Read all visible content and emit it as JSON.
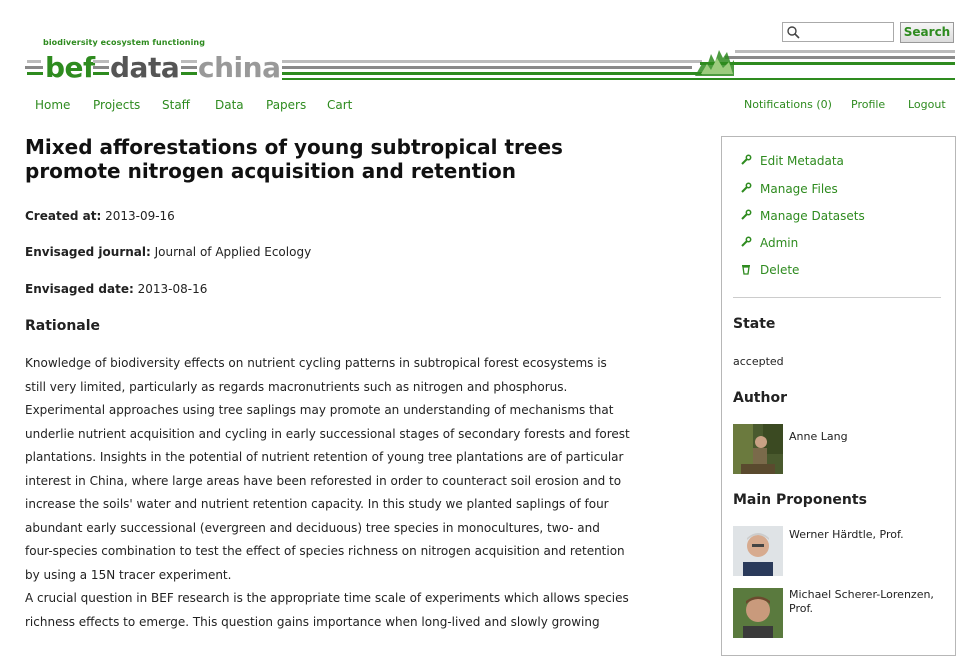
{
  "header": {
    "tagline": "biodiversity ecosystem functioning",
    "logo": {
      "bef": "bef",
      "data": "data",
      "china": "china"
    },
    "search": {
      "placeholder": "",
      "button": "Search"
    }
  },
  "nav": {
    "left": [
      "Home",
      "Projects",
      "Staff",
      "Data",
      "Papers",
      "Cart"
    ],
    "right": [
      "Notifications (0)",
      "Profile",
      "Logout"
    ]
  },
  "paper": {
    "title": "Mixed afforestations of young subtropical trees promote nitrogen acquisition and retention",
    "created_label": "Created at:",
    "created": "2013-09-16",
    "journal_label": "Envisaged journal:",
    "journal": "Journal of Applied Ecology",
    "date_label": "Envisaged date:",
    "date": "2013-08-16",
    "rationale_heading": "Rationale",
    "rationale_p1": "Knowledge of biodiversity effects on nutrient cycling patterns in subtropical forest ecosystems is still very limited, particularly as regards macronutrients such as nitrogen and phosphorus. Experimental approaches using tree saplings may promote an understanding of mechanisms that underlie nutrient acquisition and cycling in early successional stages of secondary forests and forest plantations. Insights in the potential of nutrient retention of young tree plantations are of particular interest in China, where large areas have been reforested in order to counteract soil erosion and to increase the soils' water and nutrient retention capacity. In this study we planted saplings of four abundant early successional (evergreen and deciduous) tree species in monocultures, two- and four-species combination to test the effect of species richness on nitrogen acquisition and retention by using a 15N tracer experiment.",
    "rationale_p2": "A crucial question in BEF research is the appropriate time scale of experiments which allows species richness effects to emerge. This question gains importance when long-lived and slowly growing"
  },
  "sidebar": {
    "actions": [
      "Edit Metadata",
      "Manage Files",
      "Manage Datasets",
      "Admin",
      "Delete"
    ],
    "state_heading": "State",
    "state": "accepted",
    "author_heading": "Author",
    "author": "Anne Lang",
    "proponents_heading": "Main Proponents",
    "proponents": [
      "Werner Härdtle, Prof.",
      "Michael Scherer-Lorenzen, Prof."
    ]
  },
  "colors": {
    "accent": "#2e8b1f",
    "border": "#b7b7b7"
  }
}
